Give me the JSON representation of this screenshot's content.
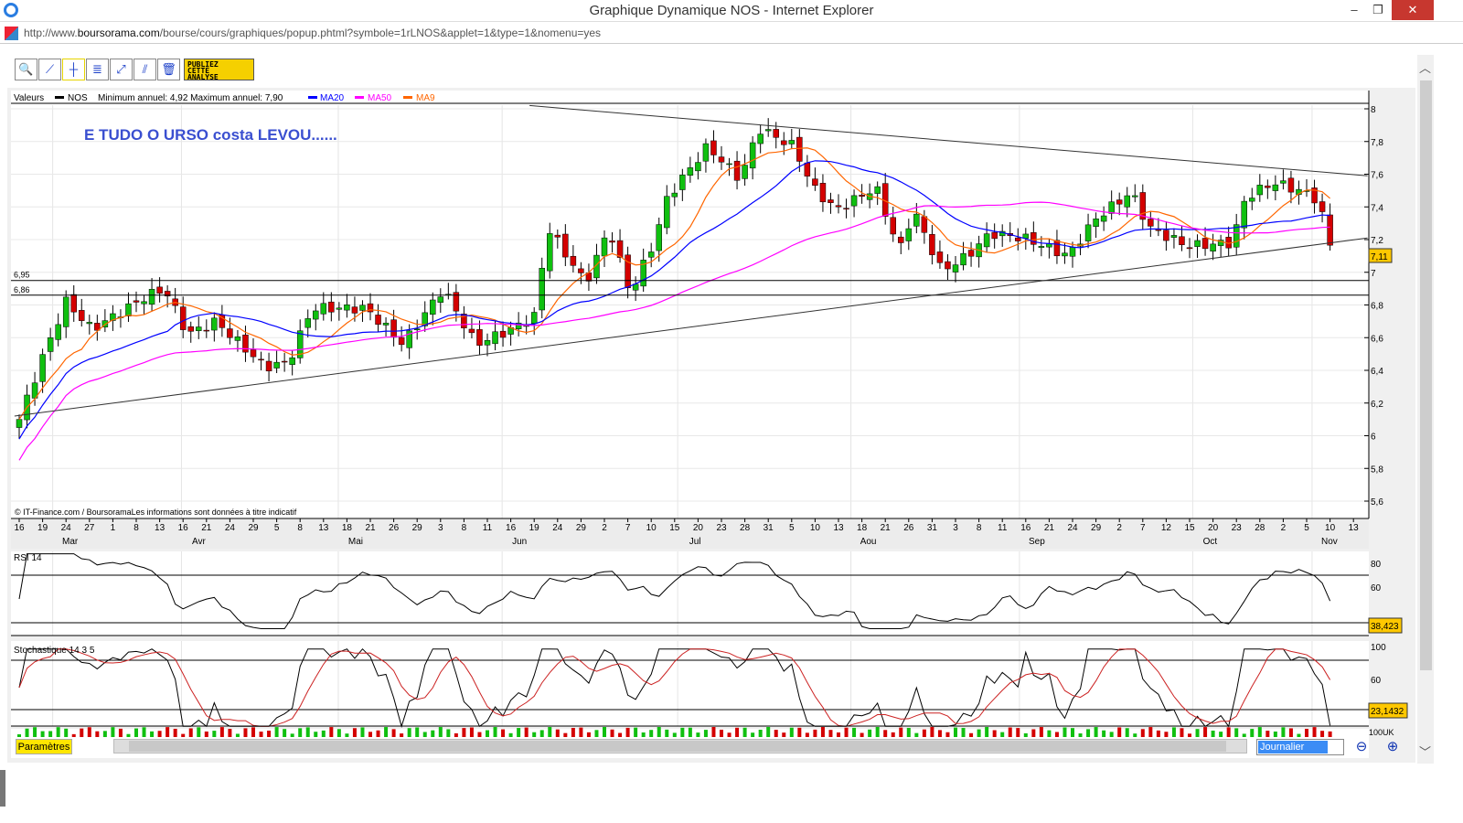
{
  "window": {
    "title": "Graphique Dynamique NOS - Internet Explorer",
    "url_prefix": "http://www.",
    "url_domain": "boursorama.com",
    "url_rest": "/bourse/cours/graphiques/popup.phtml?symbole=1rLNOS&applet=1&type=1&nomenu=yes",
    "minimize": "–",
    "restore": "❐",
    "close": "✕"
  },
  "toolbar": {
    "icons": [
      "zoom-icon",
      "trendline-icon",
      "horizontal-line-icon",
      "indicator-icon",
      "fibonacci-icon",
      "parallel-line-icon",
      "trash-icon"
    ],
    "glyphs": [
      "🔍",
      "⟋",
      "┼",
      "≣",
      "⤢",
      "⫽",
      "🗑"
    ],
    "publish": [
      "PUBLIEZ",
      "CETTE",
      "ANALYSE"
    ]
  },
  "legend": {
    "valeurs": "Valeurs",
    "symbol": "NOS",
    "minmax": "Minimum annuel: 4,92 Maximum annuel: 7,90",
    "ma20": "MA20",
    "ma50": "MA50",
    "ma9": "MA9"
  },
  "colors": {
    "up": "#10c010",
    "down": "#d40000",
    "ma20": "#0000ff",
    "ma50": "#ff00ff",
    "ma9": "#ff6600",
    "badge": "#ffc800",
    "annotation": "#3a4fd0",
    "stochSignal": "#cc2222"
  },
  "annotation": "E TUDO O URSO costa LEVOU......",
  "copyright": "© IT-Finance.com / BoursoramaLes informations sont données à titre indicatif",
  "chart_data": {
    "type": "candlestick",
    "y_ticks": [
      "8",
      "7,8",
      "7,6",
      "7,4",
      "7,2",
      "7",
      "6,8",
      "6,6",
      "6,4",
      "6,2",
      "6",
      "5,8",
      "5,6"
    ],
    "ylim": [
      5.6,
      8.0
    ],
    "day_ticks": [
      "16",
      "19",
      "24",
      "27",
      "1",
      "8",
      "13",
      "16",
      "21",
      "24",
      "29",
      "5",
      "8",
      "13",
      "18",
      "21",
      "26",
      "29",
      "3",
      "8",
      "11",
      "16",
      "19",
      "24",
      "29",
      "2",
      "7",
      "10",
      "15",
      "20",
      "23",
      "28",
      "31",
      "5",
      "10",
      "13",
      "18",
      "21",
      "26",
      "31",
      "3",
      "8",
      "11",
      "16",
      "21",
      "24",
      "29",
      "2",
      "7",
      "12",
      "15",
      "20",
      "23",
      "28",
      "2",
      "5",
      "10",
      "13"
    ],
    "months": [
      {
        "label": "Mar",
        "tick": 1.9
      },
      {
        "label": "Avr",
        "tick": 7.4
      },
      {
        "label": "Mai",
        "tick": 14.1
      },
      {
        "label": "Jun",
        "tick": 21.1
      },
      {
        "label": "Jul",
        "tick": 28.6
      },
      {
        "label": "Aou",
        "tick": 36
      },
      {
        "label": "Sep",
        "tick": 43.2
      },
      {
        "label": "Oct",
        "tick": 50.6
      },
      {
        "label": "Nov",
        "tick": 55.7
      }
    ],
    "close_anchors": [
      [
        0,
        6.1
      ],
      [
        1,
        6.48
      ],
      [
        2,
        6.82
      ],
      [
        3.1,
        6.65
      ],
      [
        5.4,
        6.85
      ],
      [
        6.2,
        6.9
      ],
      [
        7.2,
        6.62
      ],
      [
        8.4,
        6.7
      ],
      [
        10.5,
        6.42
      ],
      [
        11.5,
        6.45
      ],
      [
        12.5,
        6.78
      ],
      [
        14.8,
        6.78
      ],
      [
        16.4,
        6.56
      ],
      [
        18.1,
        6.9
      ],
      [
        19.5,
        6.56
      ],
      [
        21,
        6.65
      ],
      [
        22,
        6.73
      ],
      [
        22.6,
        7.27
      ],
      [
        24.2,
        6.93
      ],
      [
        25.2,
        7.27
      ],
      [
        26.1,
        6.87
      ],
      [
        27.1,
        7.18
      ],
      [
        27.7,
        7.46
      ],
      [
        29.4,
        7.77
      ],
      [
        30.8,
        7.57
      ],
      [
        31.6,
        7.88
      ],
      [
        33.1,
        7.77
      ],
      [
        33.9,
        7.52
      ],
      [
        34.9,
        7.38
      ],
      [
        36.6,
        7.52
      ],
      [
        37.6,
        7.13
      ],
      [
        38.2,
        7.38
      ],
      [
        39.4,
        7.01
      ],
      [
        40.5,
        7.1
      ],
      [
        41.5,
        7.24
      ],
      [
        42.9,
        7.21
      ],
      [
        43.8,
        7.16
      ],
      [
        44.8,
        7.1
      ],
      [
        46,
        7.33
      ],
      [
        47.5,
        7.49
      ],
      [
        48.3,
        7.27
      ],
      [
        49.9,
        7.16
      ],
      [
        51.8,
        7.18
      ],
      [
        52.4,
        7.46
      ],
      [
        53.6,
        7.55
      ],
      [
        54.9,
        7.49
      ],
      [
        55.5,
        7.44
      ],
      [
        56.1,
        7.11
      ]
    ],
    "hlines": [
      {
        "label": "6,95",
        "value": 6.95
      },
      {
        "label": "6,86",
        "value": 6.86
      }
    ],
    "trendlines": [
      {
        "from": [
          21.8,
          8.02
        ],
        "to": [
          57.6,
          7.59
        ]
      },
      {
        "from": [
          -0.2,
          6.12
        ],
        "to": [
          57.6,
          7.21
        ]
      }
    ],
    "last_price": "7,11",
    "rsi": {
      "title": "RSI 14",
      "ticks": [
        "80",
        "60"
      ],
      "levels": [
        70,
        30
      ],
      "last": "38,423"
    },
    "stoch": {
      "title": "Stochastique 14 3 5",
      "ticks": [
        "100",
        "60"
      ],
      "levels": [
        80,
        20
      ],
      "last": "23,1432"
    }
  },
  "bottom": {
    "params": "Paramètres",
    "period": "Journalier",
    "volume_tick": "100UK"
  }
}
